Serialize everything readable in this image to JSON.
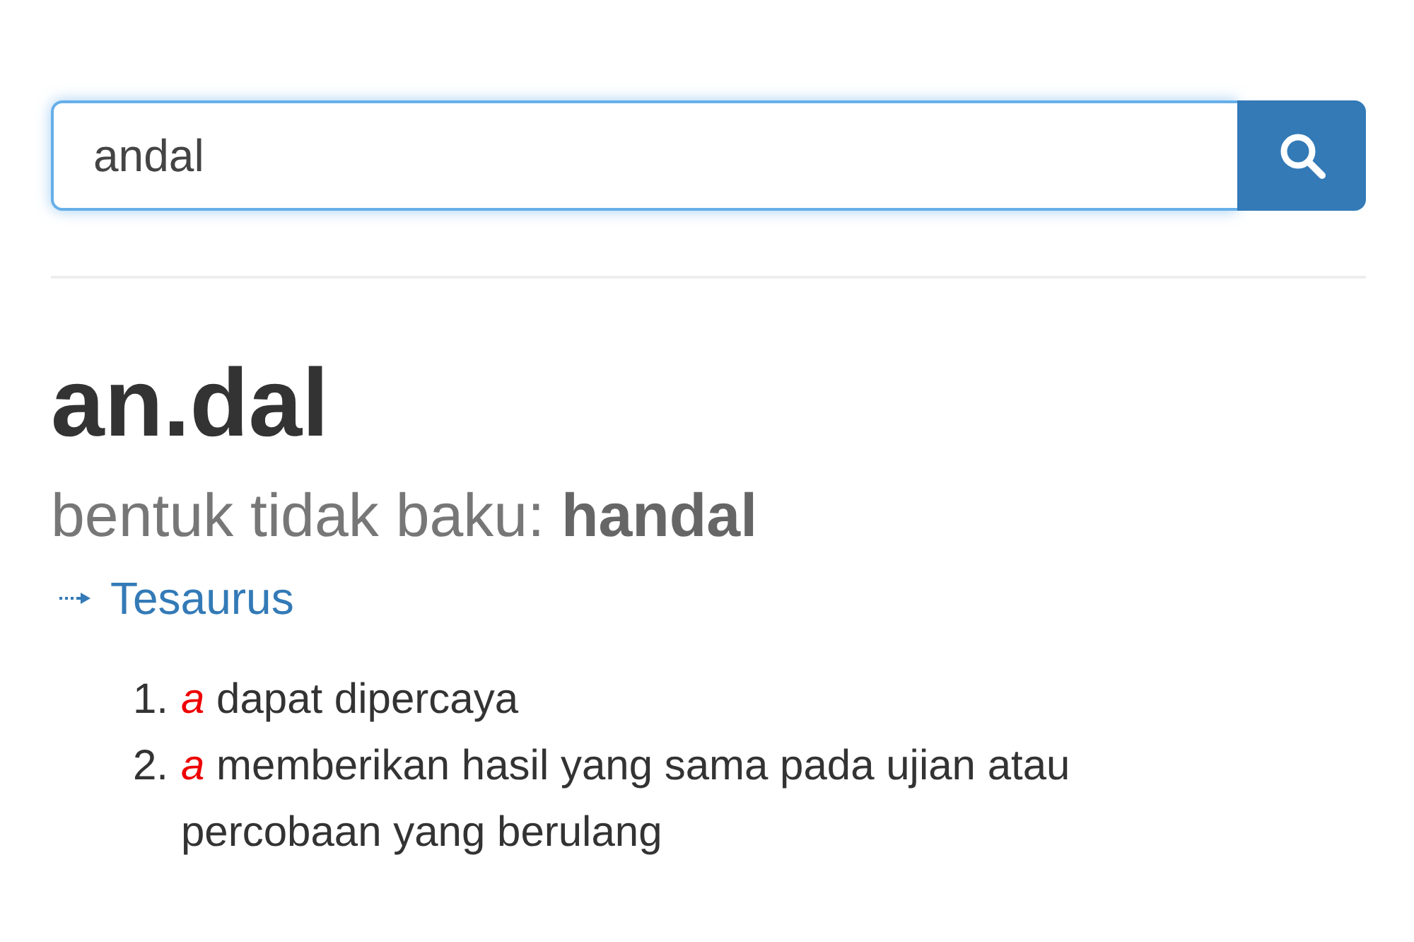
{
  "search": {
    "value": "andal"
  },
  "entry": {
    "headword": "an.dal",
    "variant_note": "bentuk tidak baku: **handal**",
    "thesaurus_link": "Tesaurus",
    "definitions": [
      {
        "number": "1.",
        "word_class": "a",
        "text": "dapat dipercaya"
      },
      {
        "number": "2.",
        "word_class": "a",
        "text": "memberikan hasil yang sama pada ujian atau percobaan yang berulang"
      }
    ]
  }
}
